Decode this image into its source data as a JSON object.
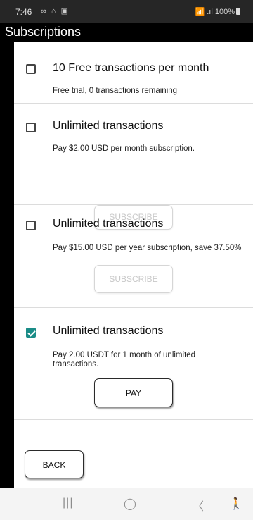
{
  "status_bar": {
    "time": "7:46",
    "left_icons": "∞ ⌂ ▣",
    "right_text": "📶 .ıl 100%"
  },
  "app_bar": {
    "title": "Subscriptions"
  },
  "plans": [
    {
      "title": "10 Free transactions per month",
      "description": "Free trial, 0 transactions remaining",
      "checked": false
    },
    {
      "title": "Unlimited transactions",
      "description": "Pay $2.00 USD per month subscription.",
      "button": "SUBSCRIBE",
      "button_enabled": false,
      "checked": false
    },
    {
      "title": "Unlimited transactions",
      "description": "Pay $15.00 USD per year subscription, save 37.50%",
      "button": "SUBSCRIBE",
      "button_enabled": false,
      "checked": false
    },
    {
      "title": "Unlimited transactions",
      "description": "Pay 2.00 USDT for 1 month of unlimited transactions.",
      "button": "PAY",
      "button_enabled": true,
      "checked": true
    }
  ],
  "footer": {
    "back_label": "BACK"
  },
  "nav_bar": {
    "recents_icon": "|||",
    "home_icon": "◯",
    "back_icon": "〈",
    "accessibility_icon": "🚶"
  },
  "colors": {
    "check_accent": "#1a8c87",
    "status_bar_bg": "#262626"
  }
}
